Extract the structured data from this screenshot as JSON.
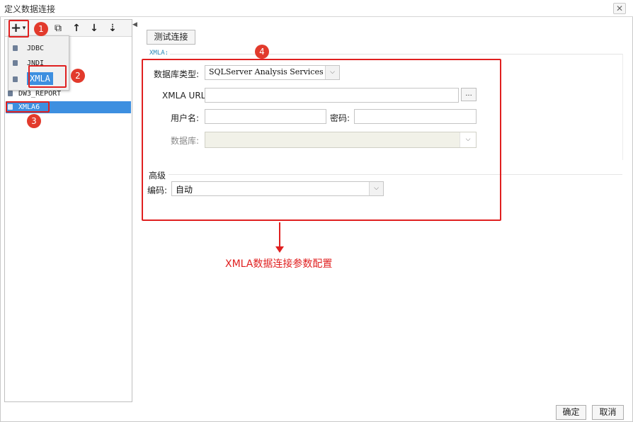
{
  "window": {
    "title": "定义数据连接",
    "close_glyph": "✕"
  },
  "toolbar": {
    "add_glyph": "+",
    "add_dropdown_glyph": "▾",
    "copy_glyph": "⧉",
    "up_glyph": "↑",
    "down_glyph": "↓",
    "sort_glyph": "⇣"
  },
  "menu": {
    "items": [
      {
        "label": "JDBC"
      },
      {
        "label": "JNDI"
      },
      {
        "label": "XMLA"
      }
    ]
  },
  "tree": {
    "items": [
      {
        "label": "DW3_REPORT"
      },
      {
        "label": "XMLA6"
      }
    ]
  },
  "annotations": {
    "badges": [
      "1",
      "2",
      "3",
      "4"
    ],
    "caption": "XMLA数据连接参数配置",
    "arrow_color": "#e02020"
  },
  "form": {
    "test_button": "测试连接",
    "section_legend": "XMLA:",
    "db_type_label": "数据库类型:",
    "db_type_value": "SQLServer Analysis Services",
    "url_label": "XMLA URL:",
    "url_value": "",
    "browse_label": "...",
    "user_label": "用户名:",
    "user_value": "",
    "password_label": "密码:",
    "password_value": "",
    "database_label": "数据库:",
    "database_value": "",
    "dropdown_glyph": "⌵"
  },
  "advanced": {
    "title": "高级",
    "encoding_label": "编码:",
    "encoding_value": "自动"
  },
  "footer": {
    "ok_label": "确定",
    "cancel_label": "取消"
  }
}
